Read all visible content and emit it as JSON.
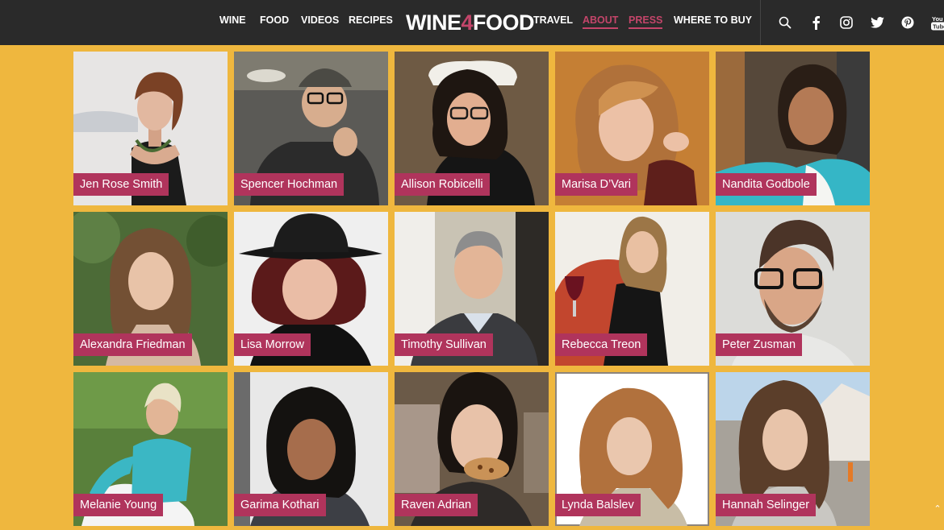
{
  "nav": {
    "left": [
      "WINE",
      "FOOD",
      "VIDEOS",
      "RECIPES"
    ],
    "right": [
      "TRAVEL",
      "ABOUT",
      "PRESS",
      "WHERE TO BUY"
    ],
    "active": [
      "ABOUT",
      "PRESS"
    ]
  },
  "logo": {
    "part1": "WINE",
    "part2": "4",
    "part3": "FOOD"
  },
  "icons": [
    "search-icon",
    "facebook-icon",
    "instagram-icon",
    "twitter-icon",
    "pinterest-icon",
    "youtube-icon"
  ],
  "youtube_text": "You Tube",
  "colors": {
    "accent": "#c4456a",
    "label_bg": "#b0345c",
    "page_bg": "#efb73e",
    "nav_bg": "#2a2a2a"
  },
  "contributors": [
    {
      "name": "Jen Rose Smith"
    },
    {
      "name": "Spencer Hochman"
    },
    {
      "name": "Allison Robicelli"
    },
    {
      "name": "Marisa D’Vari"
    },
    {
      "name": "Nandita Godbole"
    },
    {
      "name": "Alexandra Friedman"
    },
    {
      "name": "Lisa Morrow"
    },
    {
      "name": "Timothy Sullivan"
    },
    {
      "name": "Rebecca Treon"
    },
    {
      "name": "Peter Zusman"
    },
    {
      "name": "Melanie Young"
    },
    {
      "name": "Garima Kothari"
    },
    {
      "name": "Raven Adrian"
    },
    {
      "name": "Lynda Balslev"
    },
    {
      "name": "Hannah Selinger"
    }
  ]
}
